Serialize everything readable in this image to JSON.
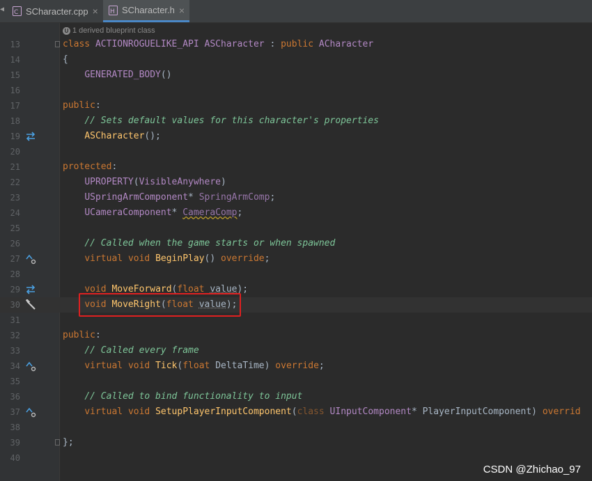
{
  "tabs": [
    {
      "label": "SCharacter.cpp",
      "active": false,
      "icon": "cpp-file-icon"
    },
    {
      "label": "SCharacter.h",
      "active": true,
      "icon": "header-file-icon"
    }
  ],
  "hint": {
    "badge": "U",
    "text": "1 derived blueprint class"
  },
  "lines": {
    "l13": {
      "num": "13",
      "t1": "class",
      "t2": "ACTIONROGUELIKE_API",
      "t3": "ASCharacter",
      "t4": ":",
      "t5": "public",
      "t6": "ACharacter"
    },
    "l14": {
      "num": "14",
      "t1": "{"
    },
    "l15": {
      "num": "15",
      "t1": "GENERATED_BODY",
      "t2": "()"
    },
    "l16": {
      "num": "16"
    },
    "l17": {
      "num": "17",
      "t1": "public",
      "t2": ":"
    },
    "l18": {
      "num": "18",
      "t1": "// Sets default values for this character's properties"
    },
    "l19": {
      "num": "19",
      "t1": "ASCharacter",
      "t2": "();"
    },
    "l20": {
      "num": "20"
    },
    "l21": {
      "num": "21",
      "t1": "protected",
      "t2": ":"
    },
    "l22": {
      "num": "22",
      "t1": "UPROPERTY",
      "t2": "(",
      "t3": "VisibleAnywhere",
      "t4": ")"
    },
    "l23": {
      "num": "23",
      "t1": "USpringArmComponent",
      "t2": "*",
      "t3": "SpringArmComp",
      "t4": ";"
    },
    "l24": {
      "num": "24",
      "t1": "UCameraComponent",
      "t2": "*",
      "t3": "CameraComp",
      "t4": ";"
    },
    "l25": {
      "num": "25"
    },
    "l26": {
      "num": "26",
      "t1": "// Called when the game starts or when spawned"
    },
    "l27": {
      "num": "27",
      "t1": "virtual",
      "t2": "void",
      "t3": "BeginPlay",
      "t4": "()",
      "t5": "override",
      "t6": ";"
    },
    "l28": {
      "num": "28"
    },
    "l29": {
      "num": "29",
      "t1": "void",
      "t2": "MoveForward",
      "t3": "(",
      "t4": "float",
      "t5": "value",
      "t6": ");"
    },
    "l30": {
      "num": "30",
      "t1": "void",
      "t2": "MoveRight",
      "t3": "(",
      "t4": "float",
      "t5": "value",
      "t6": ");"
    },
    "l31": {
      "num": "31"
    },
    "l32": {
      "num": "32",
      "t1": "public",
      "t2": ":"
    },
    "l33": {
      "num": "33",
      "t1": "// Called every frame"
    },
    "l34": {
      "num": "34",
      "t1": "virtual",
      "t2": "void",
      "t3": "Tick",
      "t4": "(",
      "t5": "float",
      "t6": "DeltaTime",
      "t7": ")",
      "t8": "override",
      "t9": ";"
    },
    "l35": {
      "num": "35"
    },
    "l36": {
      "num": "36",
      "t1": "// Called to bind functionality to input"
    },
    "l37": {
      "num": "37",
      "t1": "virtual",
      "t2": "void",
      "t3": "SetupPlayerInputComponent",
      "t4": "(",
      "t5": "class",
      "t6": "UInputComponent",
      "t7": "*",
      "t8": "PlayerInputComponent",
      "t9": ")",
      "t10": "overrid"
    },
    "l38": {
      "num": "38"
    },
    "l39": {
      "num": "39",
      "t1": "};"
    },
    "l40": {
      "num": "40"
    }
  },
  "watermark": "CSDN @Zhichao_97",
  "colors": {
    "keyword": "#cc7832",
    "function": "#ffc66d",
    "comment": "#629755",
    "highlight_box": "#e02020"
  }
}
